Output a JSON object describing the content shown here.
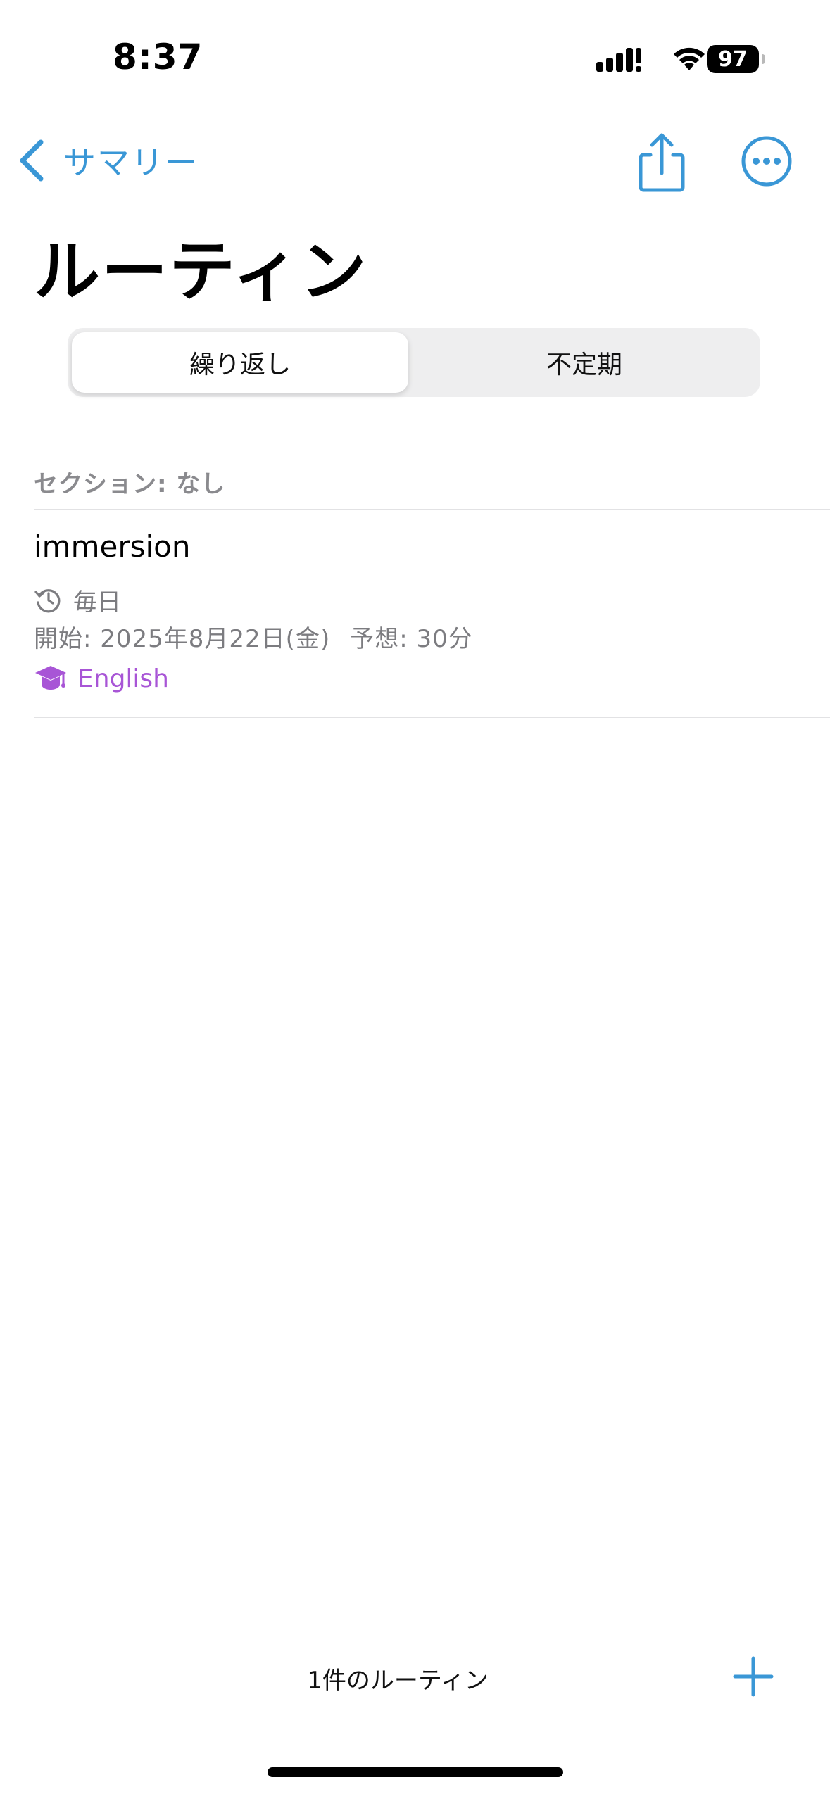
{
  "status_bar": {
    "time": "8:37",
    "battery": "97"
  },
  "nav": {
    "back_label": "サマリー"
  },
  "title": "ルーティン",
  "segments": {
    "selected": "繰り返し",
    "other": "不定期"
  },
  "section": {
    "header": "セクション: なし"
  },
  "routine": {
    "name": "immersion",
    "repeat": "毎日",
    "start": "開始: 2025年8月22日(金)",
    "estimate": "予想: 30分",
    "tag": "English",
    "tag_color": "#a855d6"
  },
  "footer": {
    "count": "1件のルーティン"
  },
  "colors": {
    "accent": "#3a97d6",
    "secondary_text": "#7c7c80"
  },
  "icons": [
    "signal-icon",
    "wifi-icon",
    "battery-icon",
    "chevron-left-icon",
    "share-icon",
    "more-icon",
    "history-icon",
    "graduation-cap-icon",
    "plus-icon"
  ]
}
